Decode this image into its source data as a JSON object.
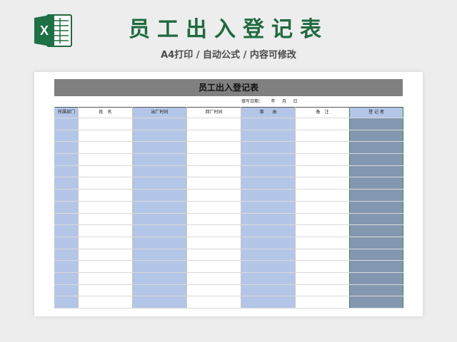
{
  "header": {
    "app_icon": "excel-icon",
    "app_icon_letter": "X",
    "title": "员工出入登记表",
    "subtitle": "A4打印 / 自动公式 / 内容可修改",
    "title_color": "#1e6b3f"
  },
  "sheet": {
    "title": "员工出入登记表",
    "date_line": "填写日期：      年     月     日",
    "columns": [
      "所属部门",
      "姓　名",
      "出厂时间",
      "回厂时间",
      "事　　由",
      "备　注",
      "登 记 者"
    ],
    "blank_rows": 16,
    "colors": {
      "title_bar": "#808080",
      "blue_column": "#b4c6e7",
      "signer_column": "#8497b0",
      "signer_border": "#3c8c4a"
    }
  }
}
